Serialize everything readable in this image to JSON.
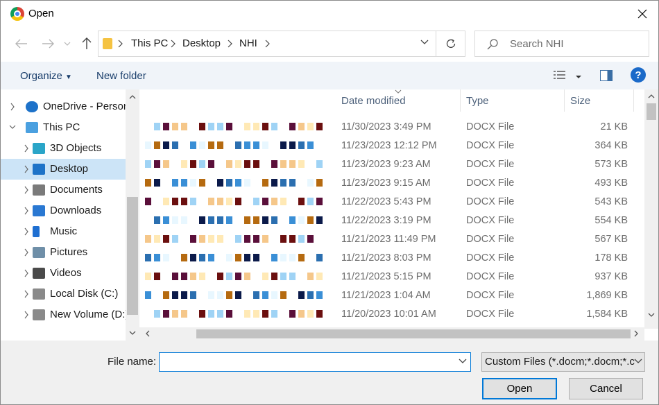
{
  "window": {
    "title": "Open"
  },
  "address": {
    "crumbs": [
      "This PC",
      "Desktop",
      "NHI"
    ]
  },
  "search": {
    "placeholder": "Search NHI"
  },
  "toolbar": {
    "organize": "Organize",
    "new_folder": "New folder",
    "help": "?"
  },
  "nav_tree": [
    {
      "label": "OneDrive - Person",
      "icon": "onedrive-icon",
      "level": 0
    },
    {
      "label": "This PC",
      "icon": "computer-icon",
      "level": 0,
      "expanded": true
    },
    {
      "label": "3D Objects",
      "icon": "cube-icon",
      "level": 1
    },
    {
      "label": "Desktop",
      "icon": "desktop-icon",
      "level": 1,
      "selected": true
    },
    {
      "label": "Documents",
      "icon": "document-icon",
      "level": 1
    },
    {
      "label": "Downloads",
      "icon": "download-icon",
      "level": 1
    },
    {
      "label": "Music",
      "icon": "music-icon",
      "level": 1
    },
    {
      "label": "Pictures",
      "icon": "picture-icon",
      "level": 1
    },
    {
      "label": "Videos",
      "icon": "video-icon",
      "level": 1
    },
    {
      "label": "Local Disk (C:)",
      "icon": "drive-icon",
      "level": 1
    },
    {
      "label": "New Volume (D:)",
      "icon": "drive-icon",
      "level": 1
    }
  ],
  "columns": {
    "date": "Date modified",
    "type": "Type",
    "size": "Size"
  },
  "files": [
    {
      "date": "11/30/2023 3:49 PM",
      "type": "DOCX File",
      "size": "21 KB"
    },
    {
      "date": "11/23/2023 12:12 PM",
      "type": "DOCX File",
      "size": "364 KB"
    },
    {
      "date": "11/23/2023 9:23 AM",
      "type": "DOCX File",
      "size": "573 KB"
    },
    {
      "date": "11/23/2023 9:15 AM",
      "type": "DOCX File",
      "size": "493 KB"
    },
    {
      "date": "11/22/2023 5:43 PM",
      "type": "DOCX File",
      "size": "543 KB"
    },
    {
      "date": "11/22/2023 3:19 PM",
      "type": "DOCX File",
      "size": "554 KB"
    },
    {
      "date": "11/21/2023 11:49 PM",
      "type": "DOCX File",
      "size": "567 KB"
    },
    {
      "date": "11/21/2023 8:03 PM",
      "type": "DOCX File",
      "size": "178 KB"
    },
    {
      "date": "11/21/2023 5:15 PM",
      "type": "DOCX File",
      "size": "937 KB"
    },
    {
      "date": "11/21/2023 1:04 AM",
      "type": "DOCX File",
      "size": "1,869 KB"
    },
    {
      "date": "11/20/2023 10:01 AM",
      "type": "DOCX File",
      "size": "1,584 KB"
    }
  ],
  "bottom": {
    "file_name_label": "File name:",
    "file_name_value": "",
    "filter": "Custom Files (*.docm;*.docm;*.c",
    "open": "Open",
    "cancel": "Cancel"
  },
  "colors": {
    "accent": "#0078d7",
    "selected": "#cce4f7"
  }
}
